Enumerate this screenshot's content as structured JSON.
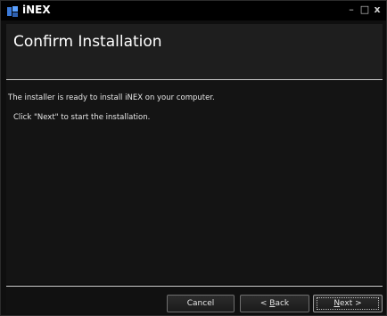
{
  "window": {
    "title": "iNEX",
    "controls": [
      "–",
      "□",
      "x"
    ]
  },
  "header": {
    "title": "Confirm Installation"
  },
  "content": {
    "line1": "The installer is ready to install iNEX on your computer.",
    "line2": "Click \"Next\" to start the installation."
  },
  "buttons": {
    "cancel": "Cancel",
    "back_prefix": "< ",
    "back_mnemonic": "B",
    "back_rest": "ack",
    "next_mnemonic": "N",
    "next_rest": "ext >"
  }
}
